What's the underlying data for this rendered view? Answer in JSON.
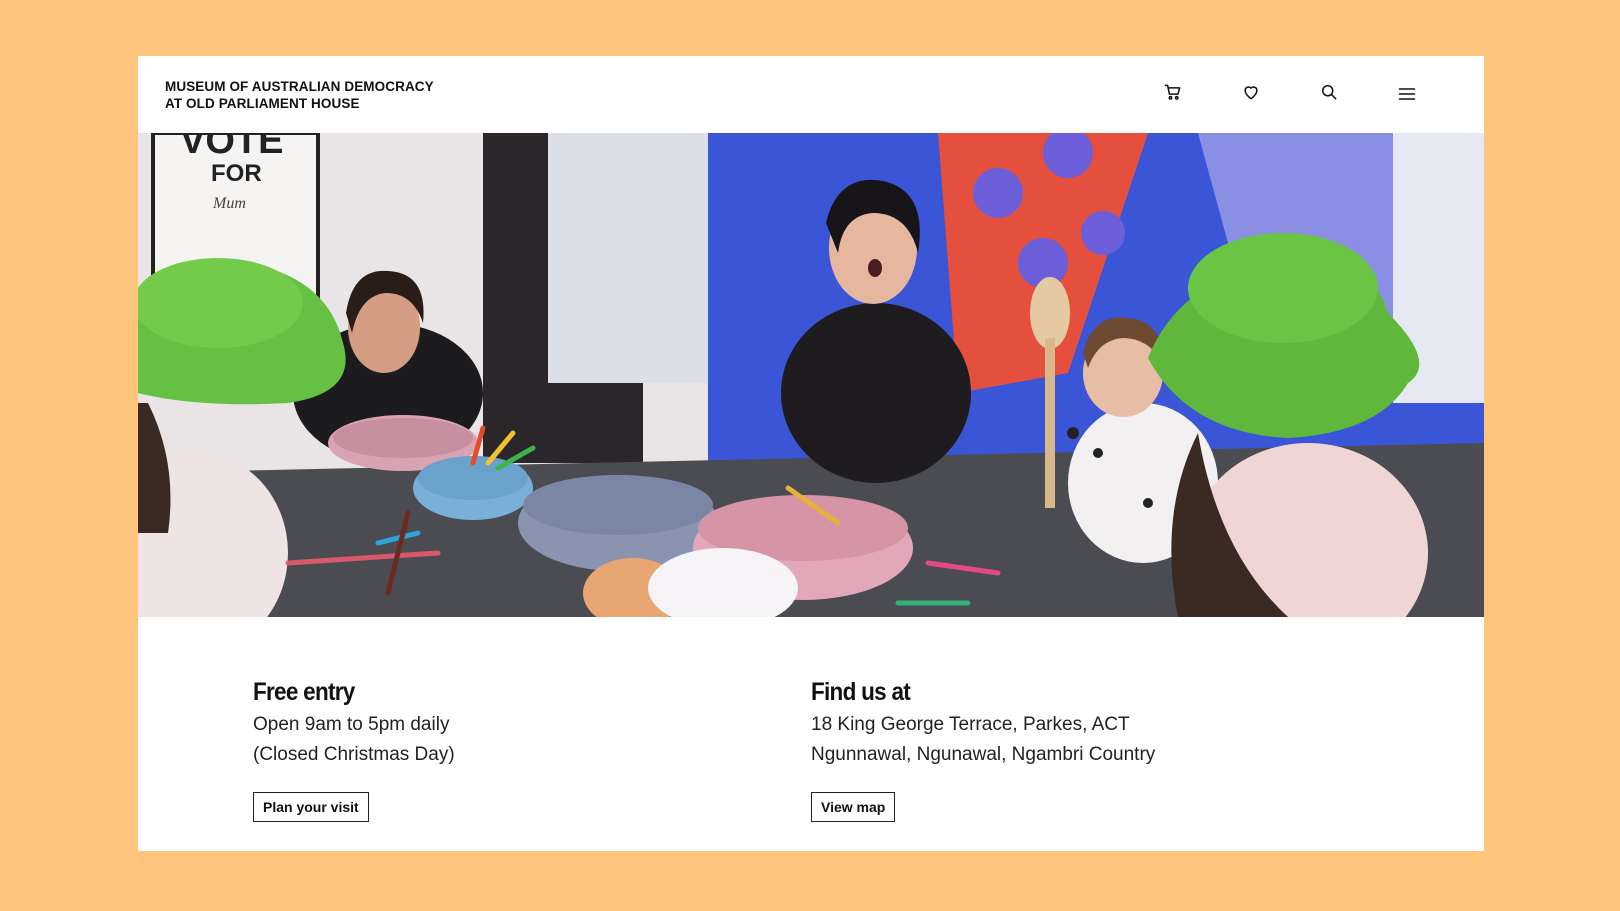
{
  "header": {
    "logo_line1": "MUSEUM OF AUSTRALIAN DEMOCRACY",
    "logo_line2": "AT OLD PARLIAMENT HOUSE",
    "icons": [
      "cart-icon",
      "heart-icon",
      "search-icon",
      "menu-icon"
    ]
  },
  "hero": {
    "poster_line1": "VOTE",
    "poster_line2": "FOR",
    "poster_line3": "Mum"
  },
  "info": {
    "left": {
      "title": "Free entry",
      "line1": "Open 9am to 5pm daily",
      "line2": "(Closed Christmas Day)",
      "button": "Plan your visit"
    },
    "right": {
      "title": "Find us at",
      "line1": "18 King George Terrace, Parkes, ACT",
      "line2": "Ngunnawal, Ngunawal, Ngambri Country",
      "button": "View map"
    }
  },
  "colors": {
    "page_background": "#FFC57D",
    "card_background": "#FFFFFF",
    "text": "#111111"
  }
}
